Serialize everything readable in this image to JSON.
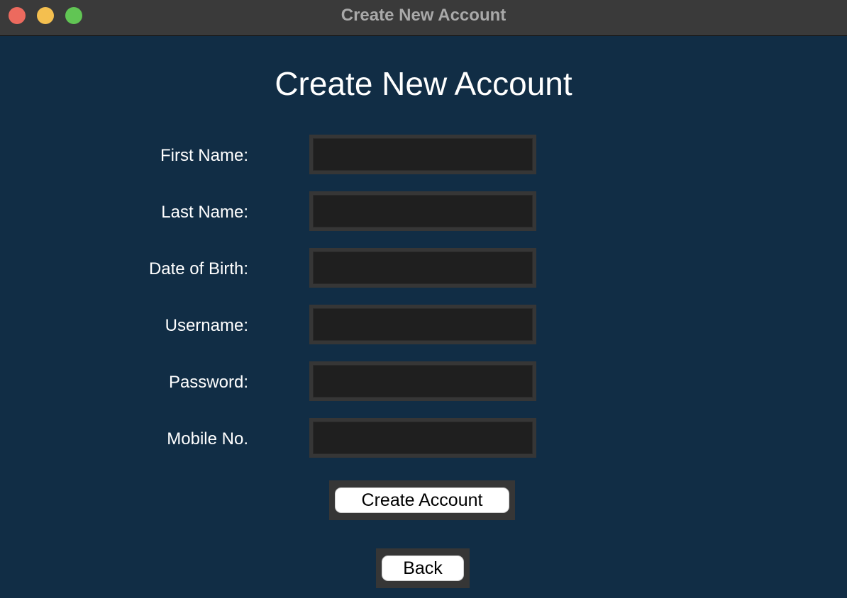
{
  "window": {
    "title": "Create New Account",
    "controls": {
      "close_color": "#ec6a5e",
      "minimize_color": "#f4bf4f",
      "zoom_color": "#61c554"
    }
  },
  "form": {
    "heading": "Create New Account",
    "fields": [
      {
        "label": "First Name:",
        "value": "",
        "placeholder": ""
      },
      {
        "label": "Last Name:",
        "value": "",
        "placeholder": ""
      },
      {
        "label": "Date of Birth:",
        "value": "",
        "placeholder": ""
      },
      {
        "label": "Username:",
        "value": "",
        "placeholder": ""
      },
      {
        "label": "Password:",
        "value": "",
        "placeholder": ""
      },
      {
        "label": "Mobile No.",
        "value": "",
        "placeholder": ""
      }
    ],
    "create_button_label": "Create Account",
    "back_button_label": "Back"
  },
  "colors": {
    "background": "#112d45",
    "field_frame": "#363636",
    "field_fill": "#1f1f1f",
    "button_fill": "#ffffff"
  }
}
